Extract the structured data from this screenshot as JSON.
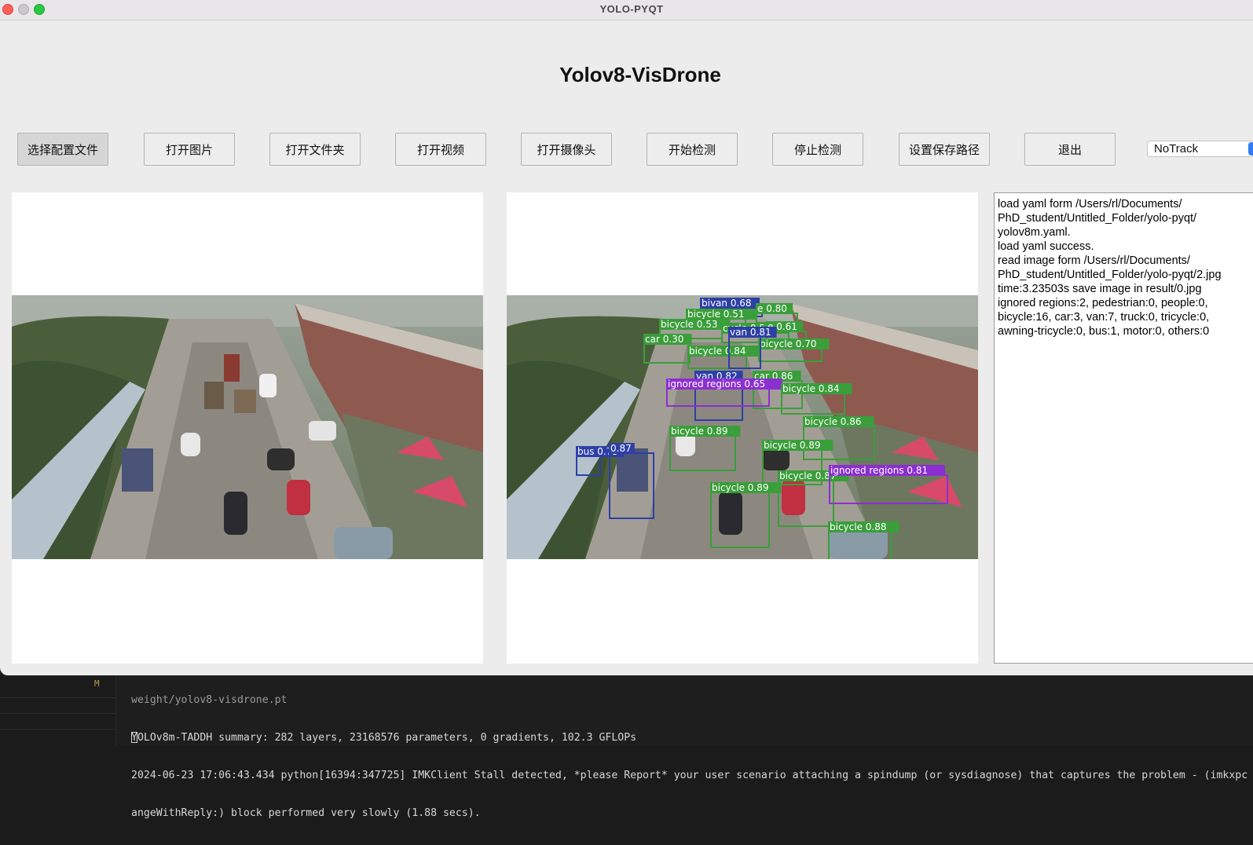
{
  "window": {
    "title": "YOLO-PYQT"
  },
  "app": {
    "heading": "Yolov8-VisDrone"
  },
  "toolbar": {
    "buttons": [
      "选择配置文件",
      "打开图片",
      "打开文件夹",
      "打开视频",
      "打开摄像头",
      "开始检测",
      "停止检测",
      "设置保存路径",
      "退出"
    ],
    "track_mode": "NoTrack"
  },
  "images": {
    "original": "source aerial drone image",
    "result": "detection result image"
  },
  "detections": [
    {
      "label": "bivan 0.68",
      "color": "#2e3fa6"
    },
    {
      "label": "bicycle 0.51",
      "color": "#3a9e3a"
    },
    {
      "label": "e 0.80",
      "color": "#3a9e3a"
    },
    {
      "label": "bicycle 0.53",
      "color": "#3a9e3a"
    },
    {
      "label": "cycle 0.57",
      "color": "#3a9e3a"
    },
    {
      "label": "e 0.61",
      "color": "#3a9e3a"
    },
    {
      "label": "car 0.30",
      "color": "#3a9e3a"
    },
    {
      "label": "bicycle 0.84",
      "color": "#3a9e3a"
    },
    {
      "label": "bicycle 0.70",
      "color": "#3a9e3a"
    },
    {
      "label": "van 0.81",
      "color": "#2e3fa6"
    },
    {
      "label": "van 0.82",
      "color": "#2e3fa6"
    },
    {
      "label": "car 0.86",
      "color": "#3a9e3a"
    },
    {
      "label": "ignored regions 0.65",
      "color": "#8b2fd0"
    },
    {
      "label": "bicycle 0.84",
      "color": "#3a9e3a"
    },
    {
      "label": "bicycle 0.86",
      "color": "#3a9e3a"
    },
    {
      "label": "bicycle 0.89",
      "color": "#3a9e3a"
    },
    {
      "label": "bus 0.75",
      "color": "#2e3fa6"
    },
    {
      "label": "0.87",
      "color": "#2e3fa6"
    },
    {
      "label": "bicycle 0.89",
      "color": "#3a9e3a"
    },
    {
      "label": "bicycle 0.87",
      "color": "#3a9e3a"
    },
    {
      "label": "ignored regions 0.81",
      "color": "#8b2fd0"
    },
    {
      "label": "bicycle 0.89",
      "color": "#3a9e3a"
    },
    {
      "label": "bicycle 0.88",
      "color": "#3a9e3a"
    }
  ],
  "log": {
    "text": "load yaml form /Users/rl/Documents/\nPhD_student/Untitled_Folder/yolo-pyqt/\nyolov8m.yaml.\nload yaml success.\nread image form /Users/rl/Documents/\nPhD_student/Untitled_Folder/yolo-pyqt/2.jpg\ntime:3.23503s save image in result/0.jpg\nignored regions:2, pedestrian:0, people:0,\nbicycle:16, car:3, van:7, truck:0, tricycle:0,\nawning-tricycle:0, bus:1, motor:0, others:0"
  },
  "terminal": {
    "marker": "M",
    "lines": [
      "weight/yolov8-visdrone.pt",
      "YOLOv8m-TADDH summary: 282 layers, 23168576 parameters, 0 gradients, 102.3 GFLOPs",
      "2024-06-23 17:06:43.434 python[16394:347725] IMKClient Stall detected, *please Report* your user scenario attaching a spindump (or sysdiagnose) that captures the problem - (imkxpc",
      "angeWithReply:) block performed very slowly (1.88 secs)."
    ]
  }
}
